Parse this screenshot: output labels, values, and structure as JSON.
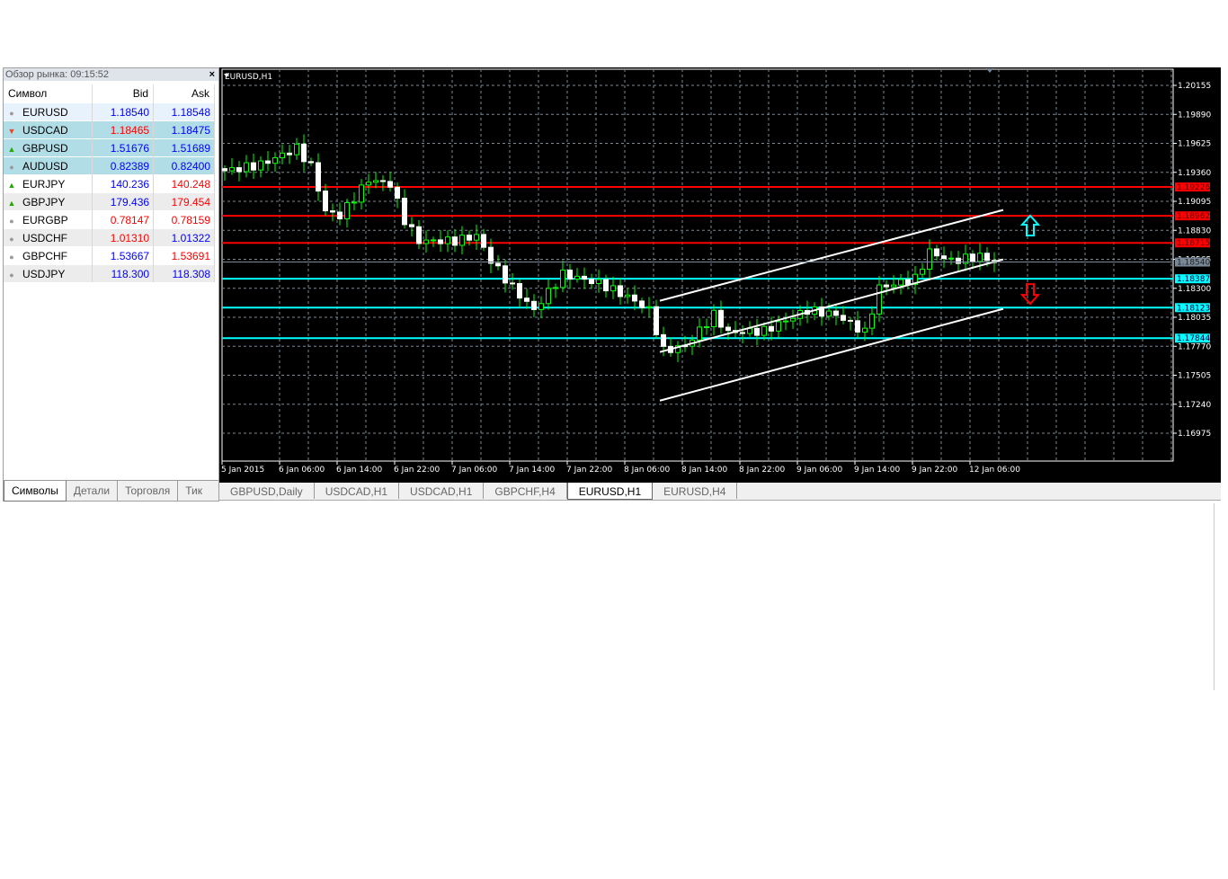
{
  "market_watch": {
    "title": "Обзор рынка: 09:15:52",
    "close": "×",
    "headers": {
      "symbol": "Символ",
      "bid": "Bid",
      "ask": "Ask"
    },
    "rows": [
      {
        "symbol": "EURUSD",
        "bid": "1.18540",
        "ask": "1.18548",
        "bid_color": "#0000ff",
        "ask_color": "#0000ff",
        "icon": "neutral",
        "style": "sel"
      },
      {
        "symbol": "USDCAD",
        "bid": "1.18465",
        "ask": "1.18475",
        "bid_color": "#ff0000",
        "ask_color": "#0000ff",
        "icon": "down",
        "style": "hl"
      },
      {
        "symbol": "GBPUSD",
        "bid": "1.51676",
        "ask": "1.51689",
        "bid_color": "#0000ff",
        "ask_color": "#0000ff",
        "icon": "up",
        "style": "hl"
      },
      {
        "symbol": "AUDUSD",
        "bid": "0.82389",
        "ask": "0.82400",
        "bid_color": "#0000ff",
        "ask_color": "#0000ff",
        "icon": "neutral",
        "style": "hl"
      },
      {
        "symbol": "EURJPY",
        "bid": "140.236",
        "ask": "140.248",
        "bid_color": "#0000ff",
        "ask_color": "#ff0000",
        "icon": "up",
        "style": ""
      },
      {
        "symbol": "GBPJPY",
        "bid": "179.436",
        "ask": "179.454",
        "bid_color": "#0000ff",
        "ask_color": "#ff0000",
        "icon": "up",
        "style": "alt"
      },
      {
        "symbol": "EURGBP",
        "bid": "0.78147",
        "ask": "0.78159",
        "bid_color": "#ff0000",
        "ask_color": "#ff0000",
        "icon": "neutral",
        "style": ""
      },
      {
        "symbol": "USDCHF",
        "bid": "1.01310",
        "ask": "1.01322",
        "bid_color": "#ff0000",
        "ask_color": "#0000ff",
        "icon": "neutral",
        "style": "alt"
      },
      {
        "symbol": "GBPCHF",
        "bid": "1.53667",
        "ask": "1.53691",
        "bid_color": "#0000ff",
        "ask_color": "#ff0000",
        "icon": "neutral",
        "style": ""
      },
      {
        "symbol": "USDJPY",
        "bid": "118.300",
        "ask": "118.308",
        "bid_color": "#0000ff",
        "ask_color": "#0000ff",
        "icon": "neutral",
        "style": "alt"
      }
    ],
    "tabs": [
      "Символы",
      "Детали",
      "Торговля",
      "Тик"
    ]
  },
  "chart_tabs": [
    "GBPUSD,Daily",
    "USDCAD,H1",
    "USDCAD,H1",
    "GBPCHF,H4",
    "EURUSD,H1",
    "EURUSD,H4"
  ],
  "active_chart_tab": 4,
  "chart_data": {
    "type": "candlestick",
    "title": "EURUSD,H1",
    "ylim": [
      1.16975,
      1.20155
    ],
    "y_ticks": [
      "1.20155",
      "1.19890",
      "1.19625",
      "1.19360",
      "1.19095",
      "1.18830",
      "1.18565",
      "1.18300",
      "1.18035",
      "1.17770",
      "1.17505",
      "1.17240",
      "1.16975"
    ],
    "x_ticks": [
      "5 Jan 2015",
      "6 Jan 06:00",
      "6 Jan 14:00",
      "6 Jan 22:00",
      "7 Jan 06:00",
      "7 Jan 14:00",
      "7 Jan 22:00",
      "8 Jan 06:00",
      "8 Jan 14:00",
      "8 Jan 22:00",
      "9 Jan 06:00",
      "9 Jan 14:00",
      "9 Jan 22:00",
      "12 Jan 06:00"
    ],
    "candle_count": 108,
    "close_keypoints": [
      [
        0,
        1.19374
      ],
      [
        5,
        1.19432
      ],
      [
        10,
        1.1958
      ],
      [
        12,
        1.19415
      ],
      [
        14,
        1.19004
      ],
      [
        16,
        1.18963
      ],
      [
        20,
        1.19292
      ],
      [
        23,
        1.19251
      ],
      [
        25,
        1.18922
      ],
      [
        27,
        1.18733
      ],
      [
        32,
        1.18733
      ],
      [
        35,
        1.18782
      ],
      [
        37,
        1.18552
      ],
      [
        40,
        1.18306
      ],
      [
        43,
        1.181
      ],
      [
        47,
        1.18429
      ],
      [
        52,
        1.18347
      ],
      [
        56,
        1.18223
      ],
      [
        59,
        1.181
      ],
      [
        61,
        1.1773
      ],
      [
        64,
        1.17771
      ],
      [
        68,
        1.18059
      ],
      [
        70,
        1.17895
      ],
      [
        75,
        1.17911
      ],
      [
        81,
        1.181
      ],
      [
        85,
        1.18059
      ],
      [
        89,
        1.17895
      ],
      [
        91,
        1.18306
      ],
      [
        96,
        1.18388
      ],
      [
        98,
        1.18634
      ],
      [
        101,
        1.18552
      ],
      [
        105,
        1.18593
      ],
      [
        107,
        1.1854
      ]
    ],
    "h_lines": [
      {
        "price": "1.19226",
        "color": "#ff0000"
      },
      {
        "price": "1.18962",
        "color": "#ff0000"
      },
      {
        "price": "1.18715",
        "color": "#ff0000"
      },
      {
        "price": "1.18387",
        "color": "#00ffff"
      },
      {
        "price": "1.18123",
        "color": "#00ffff"
      },
      {
        "price": "1.17844",
        "color": "#00ffff"
      }
    ],
    "bid_label": {
      "price": "1.18540",
      "color": "#778899"
    },
    "trend_lines": [
      [
        [
          61,
          1.18186
        ],
        [
          108,
          1.19016
        ]
      ],
      [
        [
          61,
          1.17717
        ],
        [
          108,
          1.18564
        ]
      ],
      [
        [
          61,
          1.17273
        ],
        [
          108,
          1.18112
        ]
      ]
    ],
    "arrows": [
      {
        "dir": "up",
        "index": 112,
        "price": 1.18865,
        "color": "#00ffff"
      },
      {
        "dir": "down",
        "index": 112,
        "price": 1.18256,
        "color": "#ff0000"
      }
    ]
  }
}
